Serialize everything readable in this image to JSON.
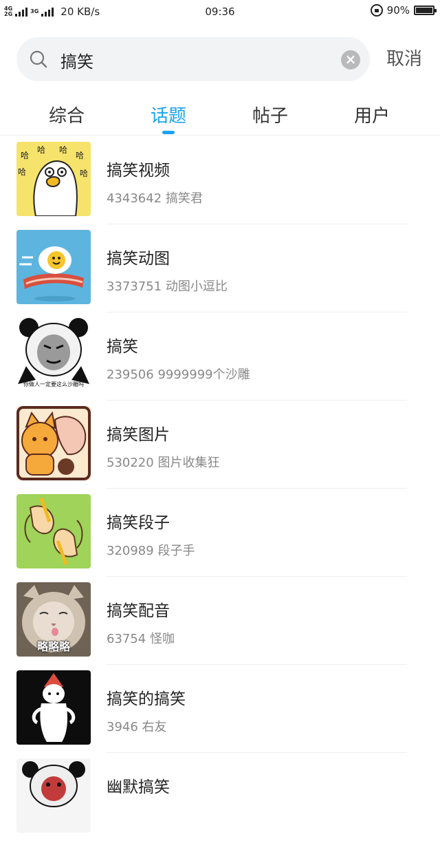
{
  "status_bar": {
    "network_top": "4G",
    "network_bottom": "2G",
    "network_3g": "3G",
    "speed": "20 KB/s",
    "time": "09:36",
    "battery": "90%"
  },
  "search": {
    "query": "搞笑",
    "cancel_label": "取消"
  },
  "tabs": [
    {
      "label": "综合",
      "active": false
    },
    {
      "label": "话题",
      "active": true
    },
    {
      "label": "帖子",
      "active": false
    },
    {
      "label": "用户",
      "active": false
    }
  ],
  "topics": [
    {
      "title": "搞笑视频",
      "count": "4343642",
      "owner": "搞笑君",
      "thumb_icon": "duck-meme-icon",
      "thumb_bg": "#f6e36b"
    },
    {
      "title": "搞笑动图",
      "count": "3373751",
      "owner": "动图小逗比",
      "thumb_icon": "egg-bacon-icon",
      "thumb_bg": "#5db5df"
    },
    {
      "title": "搞笑",
      "count": "239506",
      "owner": "9999999个沙雕",
      "thumb_icon": "panda-meme-icon",
      "thumb_bg": "#ffffff",
      "thumb_caption": "你做人一定要这么沙雕吗"
    },
    {
      "title": "搞笑图片",
      "count": "530220",
      "owner": "图片收集狂",
      "thumb_icon": "cat-cartoon-icon",
      "thumb_bg": "#fbe9d0"
    },
    {
      "title": "搞笑段子",
      "count": "320989",
      "owner": "段子手",
      "thumb_icon": "drawing-hands-icon",
      "thumb_bg": "#9fd35a"
    },
    {
      "title": "搞笑配音",
      "count": "63754",
      "owner": "怪咖",
      "thumb_icon": "cat-photo-icon",
      "thumb_bg": "#8a7c6c",
      "thumb_caption": "略略略"
    },
    {
      "title": "搞笑的搞笑",
      "count": "3946",
      "owner": "右友",
      "thumb_icon": "cartoon-character-icon",
      "thumb_bg": "#0d0d0d"
    },
    {
      "title": "幽默搞笑",
      "count": "",
      "owner": "",
      "thumb_icon": "panda-meme-icon",
      "thumb_bg": "#f5f5f5"
    }
  ]
}
